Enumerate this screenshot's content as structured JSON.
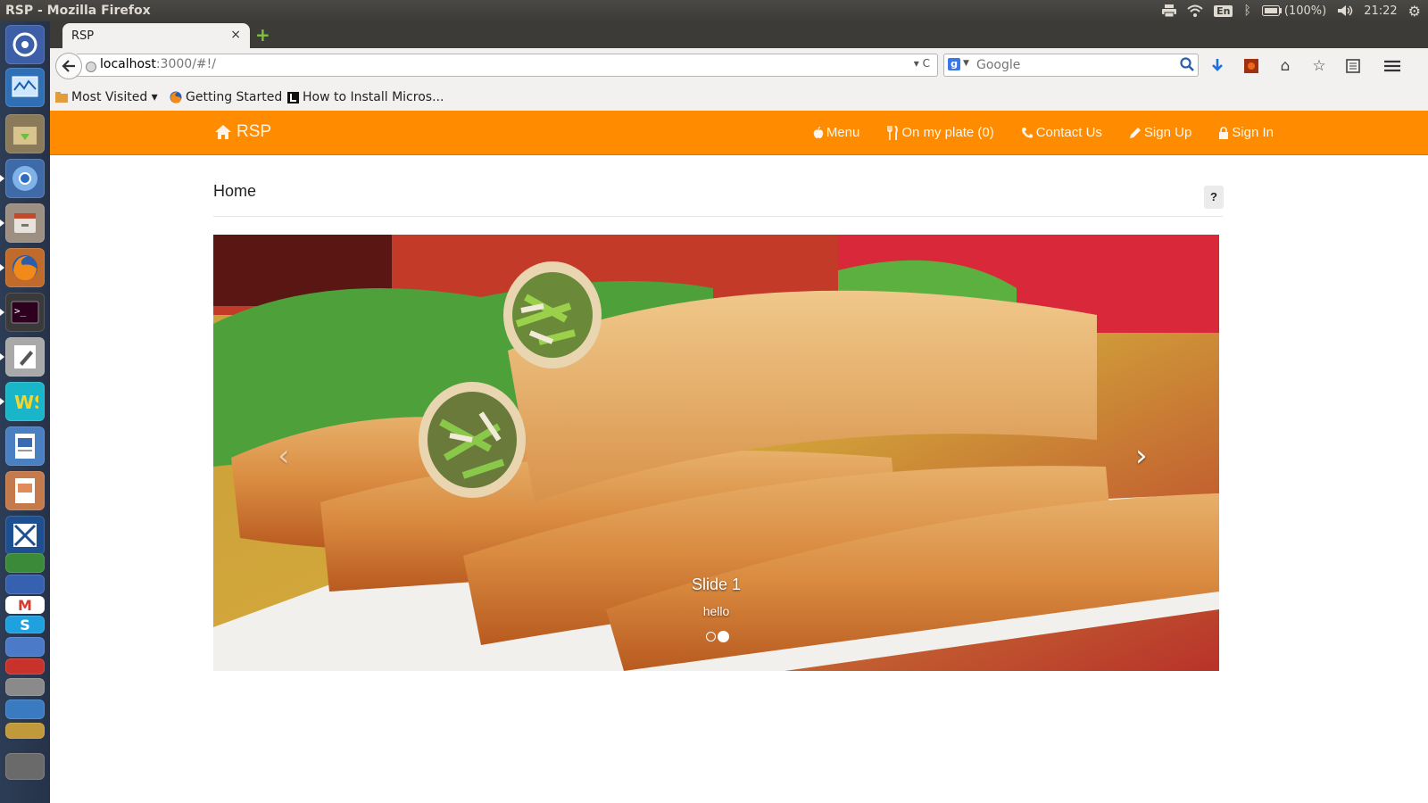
{
  "system": {
    "window_title": "RSP - Mozilla Firefox",
    "lang": "En",
    "battery": "(100%)",
    "clock": "21:22"
  },
  "browser": {
    "tab_title": "RSP",
    "tab_close": "×",
    "new_tab": "+",
    "url_host": "localhost",
    "url_path": ":3000/#!/",
    "url_controls": "▾ C",
    "search_placeholder": "Google",
    "bookmarks": [
      {
        "label": "Most Visited ▾"
      },
      {
        "label": "Getting Started"
      },
      {
        "label": "How to Install Micros..."
      }
    ]
  },
  "site": {
    "brand": "RSP",
    "nav": {
      "menu": "Menu",
      "plate": "On my plate (0)",
      "contact": "Contact Us",
      "signup": "Sign Up",
      "signin": "Sign In"
    },
    "page_title": "Home",
    "help_label": "?",
    "carousel": {
      "prev": "‹",
      "next": "›",
      "slide_title": "Slide 1",
      "slide_text": "hello",
      "slide_count": 2,
      "active_slide": 2
    }
  },
  "colors": {
    "accent": "#ff8c00",
    "launcher": "#2b3a52"
  }
}
